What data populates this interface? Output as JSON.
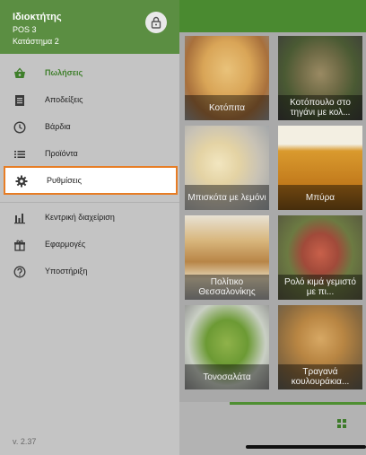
{
  "drawer": {
    "owner": "Ιδιοκτήτης",
    "pos": "POS 3",
    "store": "Κατάστημα 2",
    "lock_icon": "lock-icon",
    "items": [
      {
        "label": "Πωλήσεις",
        "icon": "basket-icon",
        "state": "active"
      },
      {
        "label": "Αποδείξεις",
        "icon": "receipt-icon"
      },
      {
        "label": "Βάρδια",
        "icon": "clock-icon"
      },
      {
        "label": "Προϊόντα",
        "icon": "list-icon"
      },
      {
        "label": "Ρυθμίσεις",
        "icon": "gear-icon",
        "state": "highlighted"
      },
      {
        "label": "Κεντρική διαχείριση",
        "icon": "bar-chart-icon"
      },
      {
        "label": "Εφαρμογές",
        "icon": "apps-icon"
      },
      {
        "label": "Υποστήριξη",
        "icon": "help-icon"
      }
    ],
    "version": "v. 2.37"
  },
  "products": [
    {
      "name": "Κοτόπιτα"
    },
    {
      "name": "Κοτόπουλο στο τηγάνι με κολ..."
    },
    {
      "name": "Μπισκότα με λεμόνι"
    },
    {
      "name": "Μπύρα"
    },
    {
      "name": "Πολίτικο Θεσσαλονίκης"
    },
    {
      "name": "Ρολό κιμά γεμιστό με πι..."
    },
    {
      "name": "Τονοσαλάτα"
    },
    {
      "name": "Τραγανά κουλουράκια..."
    }
  ],
  "colors": {
    "brand": "#5b8e42",
    "highlight_border": "#e77d25",
    "active_text": "#3f7f2b"
  },
  "bottom": {
    "view_icon": "grid-view-icon"
  }
}
